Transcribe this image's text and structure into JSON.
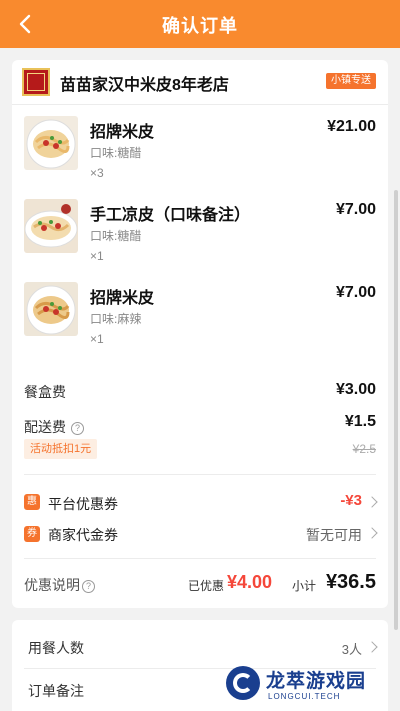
{
  "header": {
    "title": "确认订单"
  },
  "shop": {
    "name": "苗苗家汉中米皮8年老店",
    "delivery_badge": "小镇专送"
  },
  "items": [
    {
      "name": "招牌米皮",
      "flavor": "口味:糖醋",
      "qty": "×3",
      "price": "¥21.00"
    },
    {
      "name": "手工凉皮（口味备注）",
      "flavor": "口味:糖醋",
      "qty": "×1",
      "price": "¥7.00"
    },
    {
      "name": "招牌米皮",
      "flavor": "口味:麻辣",
      "qty": "×1",
      "price": "¥7.00"
    }
  ],
  "fees": {
    "box_label": "餐盒费",
    "box_value": "¥3.00",
    "delivery_label": "配送费",
    "delivery_value": "¥1.5",
    "promo_tag": "活动抵扣1元",
    "delivery_original": "¥2.5"
  },
  "coupons": {
    "platform_icon": "惠",
    "platform_label": "平台优惠券",
    "platform_value": "-¥3",
    "merchant_icon": "券",
    "merchant_label": "商家代金券",
    "merchant_value": "暂无可用"
  },
  "summary": {
    "label": "优惠说明",
    "discount_label": "已优惠",
    "discount_value": "¥4.00",
    "subtotal_label": "小计",
    "subtotal_value": "¥36.5"
  },
  "extra": {
    "diners_label": "用餐人数",
    "diners_value": "3人",
    "remark_label": "订单备注"
  },
  "watermark": {
    "title": "龙萃游戏园",
    "subtitle": "LONGCUI.TECH"
  },
  "colors": {
    "header": "#f98a2e",
    "accent": "#f5732d",
    "discount": "#f5473a"
  }
}
